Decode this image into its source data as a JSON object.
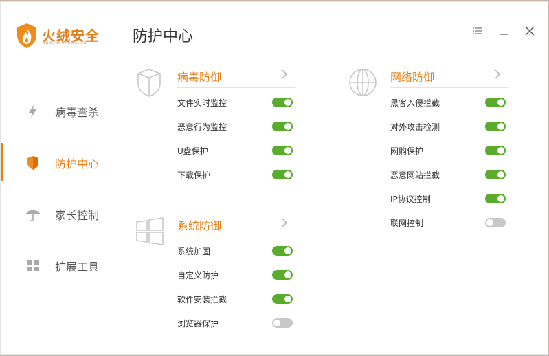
{
  "app": {
    "name": "火绒安全",
    "subtitle": "WWW.HUORONG.CN",
    "page_title": "防护中心",
    "accent": "#f07d0c"
  },
  "window_controls": {
    "menu_icon": "menu-lines-icon",
    "minimize_icon": "minimize-icon",
    "close_icon": "close-icon"
  },
  "sidebar": {
    "items": [
      {
        "label": "病毒查杀",
        "icon": "lightning-icon",
        "active": false
      },
      {
        "label": "防护中心",
        "icon": "shield-icon",
        "active": true
      },
      {
        "label": "家长控制",
        "icon": "umbrella-icon",
        "active": false
      },
      {
        "label": "扩展工具",
        "icon": "grid-icon",
        "active": false
      }
    ]
  },
  "sections": {
    "virus": {
      "title": "病毒防御",
      "icon": "shield-outline-icon",
      "items": [
        {
          "label": "文件实时监控",
          "on": true
        },
        {
          "label": "恶意行为监控",
          "on": true
        },
        {
          "label": "U盘保护",
          "on": true
        },
        {
          "label": "下载保护",
          "on": true
        }
      ]
    },
    "system": {
      "title": "系统防御",
      "icon": "windows-icon",
      "items": [
        {
          "label": "系统加固",
          "on": true
        },
        {
          "label": "自定义防护",
          "on": true
        },
        {
          "label": "软件安装拦截",
          "on": true
        },
        {
          "label": "浏览器保护",
          "on": false
        }
      ]
    },
    "network": {
      "title": "网络防御",
      "icon": "globe-icon",
      "items": [
        {
          "label": "黑客入侵拦截",
          "on": true
        },
        {
          "label": "对外攻击检测",
          "on": true
        },
        {
          "label": "网购保护",
          "on": true
        },
        {
          "label": "恶意网站拦截",
          "on": true
        },
        {
          "label": "IP协议控制",
          "on": true
        },
        {
          "label": "联网控制",
          "on": false
        }
      ]
    }
  },
  "colors": {
    "toggle_on": "#5aac2f",
    "toggle_off": "#c8c8c8",
    "section_title": "#e67e16"
  }
}
